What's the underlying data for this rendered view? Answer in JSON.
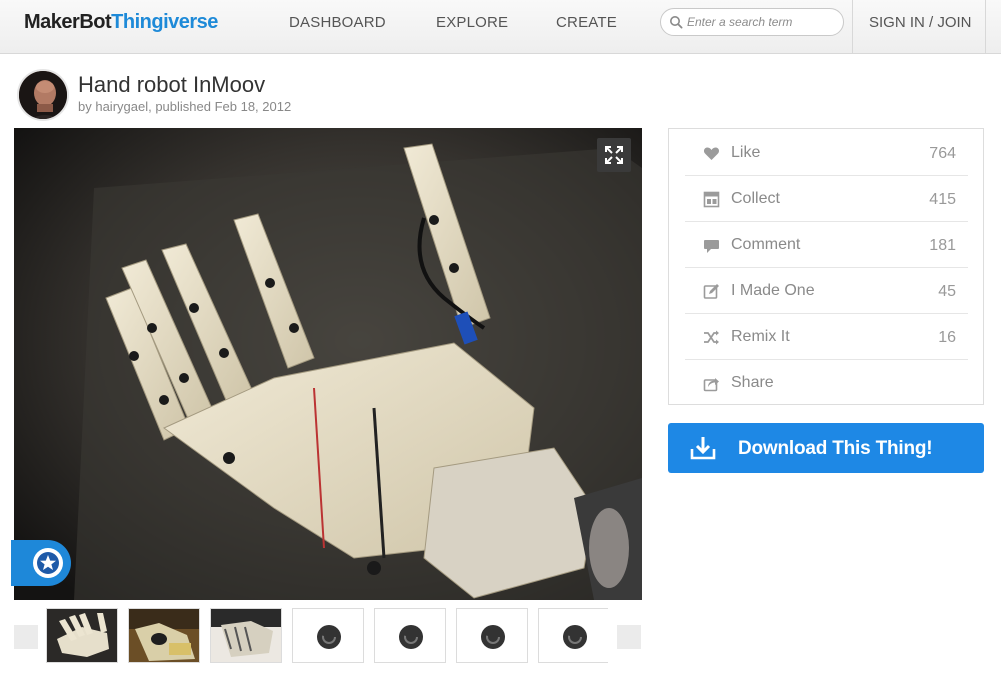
{
  "header": {
    "logo_makerbot": "MakerBot",
    "logo_thingiverse": "Thingiverse",
    "nav": {
      "dashboard": "DASHBOARD",
      "explore": "EXPLORE",
      "create": "CREATE"
    },
    "search_placeholder": "Enter a search term",
    "signin": "SIGN IN / JOIN"
  },
  "thing": {
    "title": "Hand robot InMoov",
    "meta": "by hairygael, published Feb 18, 2012"
  },
  "stats": [
    {
      "icon": "heart-icon",
      "label": "Like",
      "count": "764"
    },
    {
      "icon": "collect-icon",
      "label": "Collect",
      "count": "415"
    },
    {
      "icon": "comment-icon",
      "label": "Comment",
      "count": "181"
    },
    {
      "icon": "edit-icon",
      "label": "I Made One",
      "count": "45"
    },
    {
      "icon": "remix-icon",
      "label": "Remix It",
      "count": "16"
    },
    {
      "icon": "share-icon",
      "label": "Share",
      "count": ""
    }
  ],
  "download": {
    "label": "Download This Thing!"
  },
  "colors": {
    "accent": "#1e88e5",
    "brand_blue": "#1e8ad8",
    "header_bg": "#eeeeee"
  }
}
